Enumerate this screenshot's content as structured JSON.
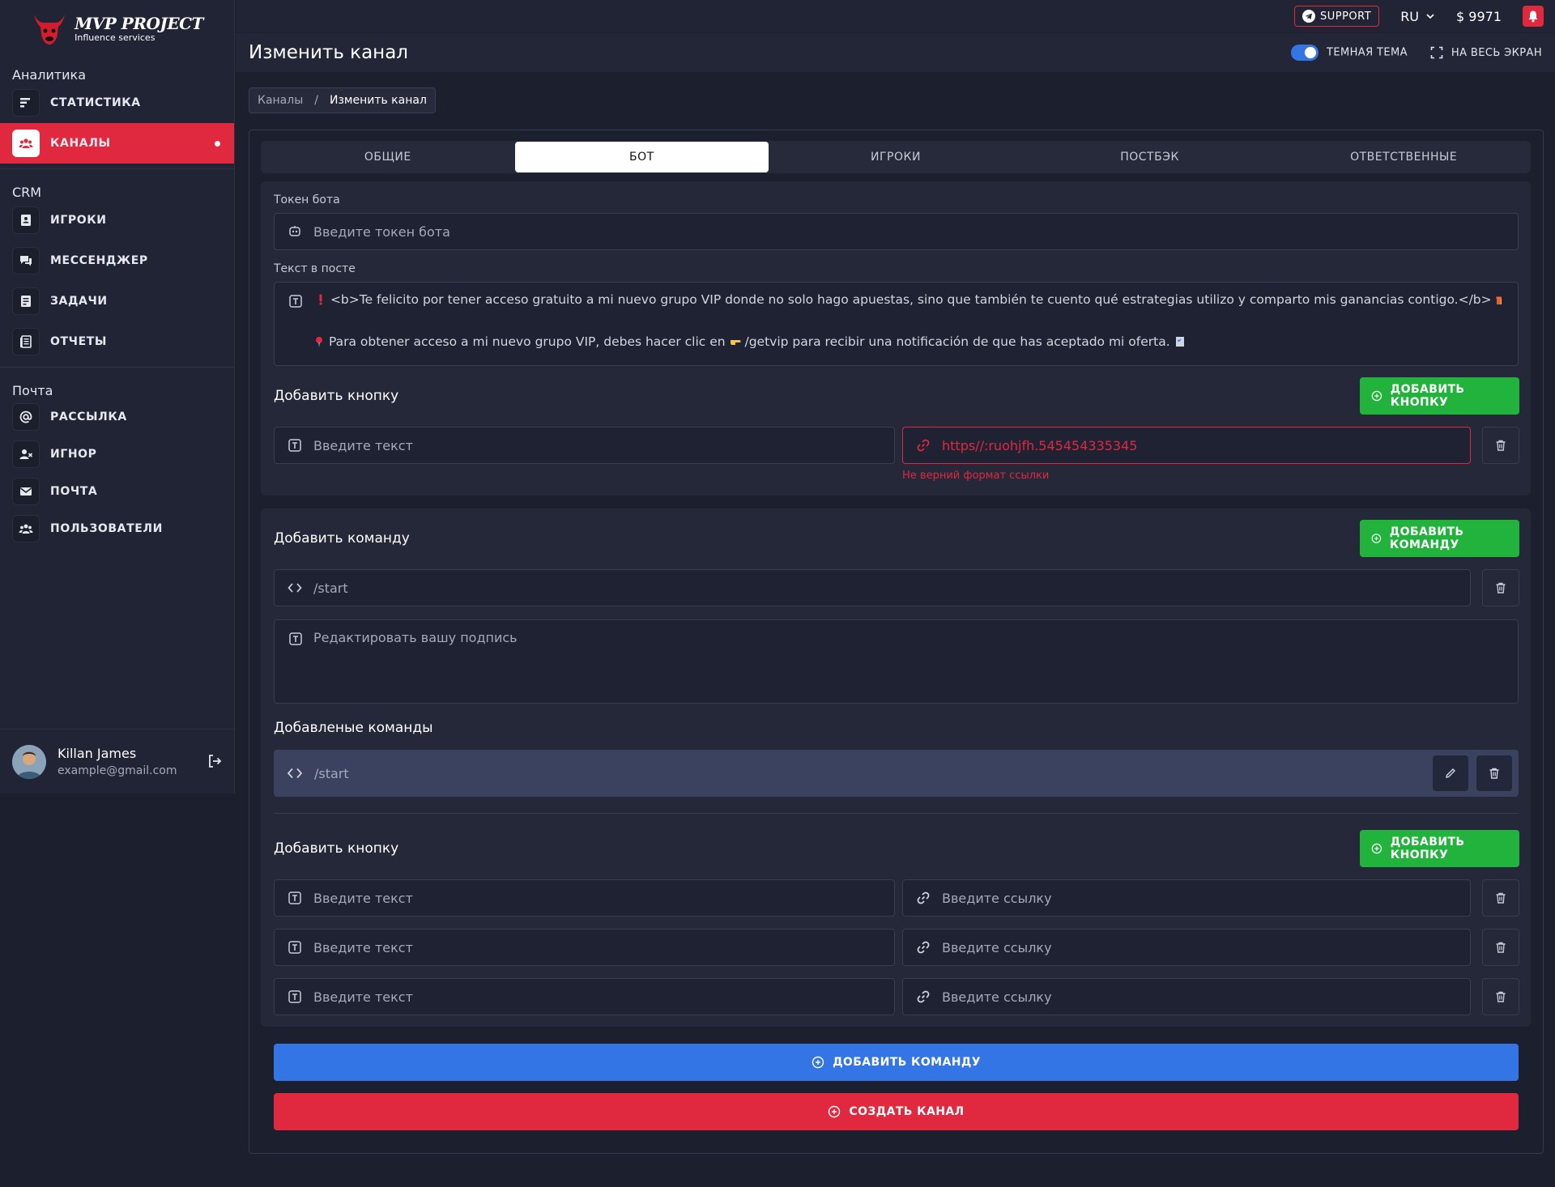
{
  "brand": {
    "name": "MVP PROJECT",
    "tagline": "Influence services"
  },
  "sidebar": {
    "sections": [
      {
        "title": "Аналитика",
        "items": [
          {
            "label": "СТАТИСТИКА",
            "icon": "chart-bars-icon"
          },
          {
            "label": "КАНАЛЫ",
            "icon": "users-group-icon",
            "active": true
          }
        ]
      },
      {
        "title": "CRM",
        "items": [
          {
            "label": "ИГРОКИ",
            "icon": "address-book-icon"
          },
          {
            "label": "МЕССЕНДЖЕР",
            "icon": "chat-icon"
          },
          {
            "label": "ЗАДАЧИ",
            "icon": "tasks-icon"
          },
          {
            "label": "ОТЧЕТЫ",
            "icon": "report-icon"
          }
        ]
      },
      {
        "title": "Почта",
        "items": [
          {
            "label": "РАССЫЛКА",
            "icon": "at-sign-icon"
          },
          {
            "label": "ИГНОР",
            "icon": "user-block-icon"
          },
          {
            "label": "ПОЧТА",
            "icon": "mail-icon"
          },
          {
            "label": "ПОЛЬЗОВАТЕЛИ",
            "icon": "users-icon"
          }
        ]
      }
    ],
    "user": {
      "name": "Killan James",
      "email": "example@gmail.com"
    }
  },
  "topbar": {
    "support": "SUPPORT",
    "lang": "RU",
    "balance": "$ 9971"
  },
  "header": {
    "title": "Изменить канал",
    "theme_label": "ТЕМНАЯ ТЕМА",
    "fullscreen_label": "НА ВЕСЬ ЭКРАН"
  },
  "breadcrumb": {
    "parent": "Каналы",
    "separator": "/",
    "current": "Изменить канал"
  },
  "tabs": [
    "ОБЩИЕ",
    "БОТ",
    "ИГРОКИ",
    "ПОСТБЭК",
    "ОТВЕТСТВЕННЫЕ"
  ],
  "active_tab": "БОТ",
  "bot": {
    "token_label": "Токен бота",
    "token_placeholder": "Введите токен бота",
    "post_label": "Текст в посте",
    "post_line1": "<b>Te felicito por tener acceso gratuito a mi nuevo grupo VIP donde no solo hago apuestas, sino que también te cuento qué estrategias utilizo y comparto mis ganancias contigo.</b>",
    "post_line2a": "Para obtener acceso a mi nuevo grupo VIP, debes hacer clic en",
    "post_line2b": "/getvip para recibir una notificación de que has aceptado mi oferta.",
    "add_button_title": "Добавить кнопку",
    "add_button_label": "ДОБАВИТЬ КНОПКУ",
    "button_text_placeholder": "Введите текст",
    "button_link_value": "https//:ruohjfh.545454335345",
    "link_error": "Не верний формат ссылки"
  },
  "commands": {
    "title": "Добавить команду",
    "add_label": "ДОБАВИТЬ КОМАНДУ",
    "command_value": "/start",
    "caption_placeholder": "Редактировать вашу подпись",
    "added_title": "Добавленые команды",
    "added": [
      "/start"
    ],
    "add_button_title": "Добавить кнопку",
    "add_button_label": "ДОБАВИТЬ КНОПКУ",
    "text_placeholder": "Введите текст",
    "link_placeholder": "Введите ссылку"
  },
  "actions": {
    "add_command": "ДОБАВИТЬ КОМАНДУ",
    "create_channel": "СОЗДАТЬ КАНАЛ"
  },
  "colors": {
    "accent_red": "#e0283f",
    "accent_green": "#22b33d",
    "accent_blue": "#3475e6",
    "background": "#1c1f2d"
  }
}
